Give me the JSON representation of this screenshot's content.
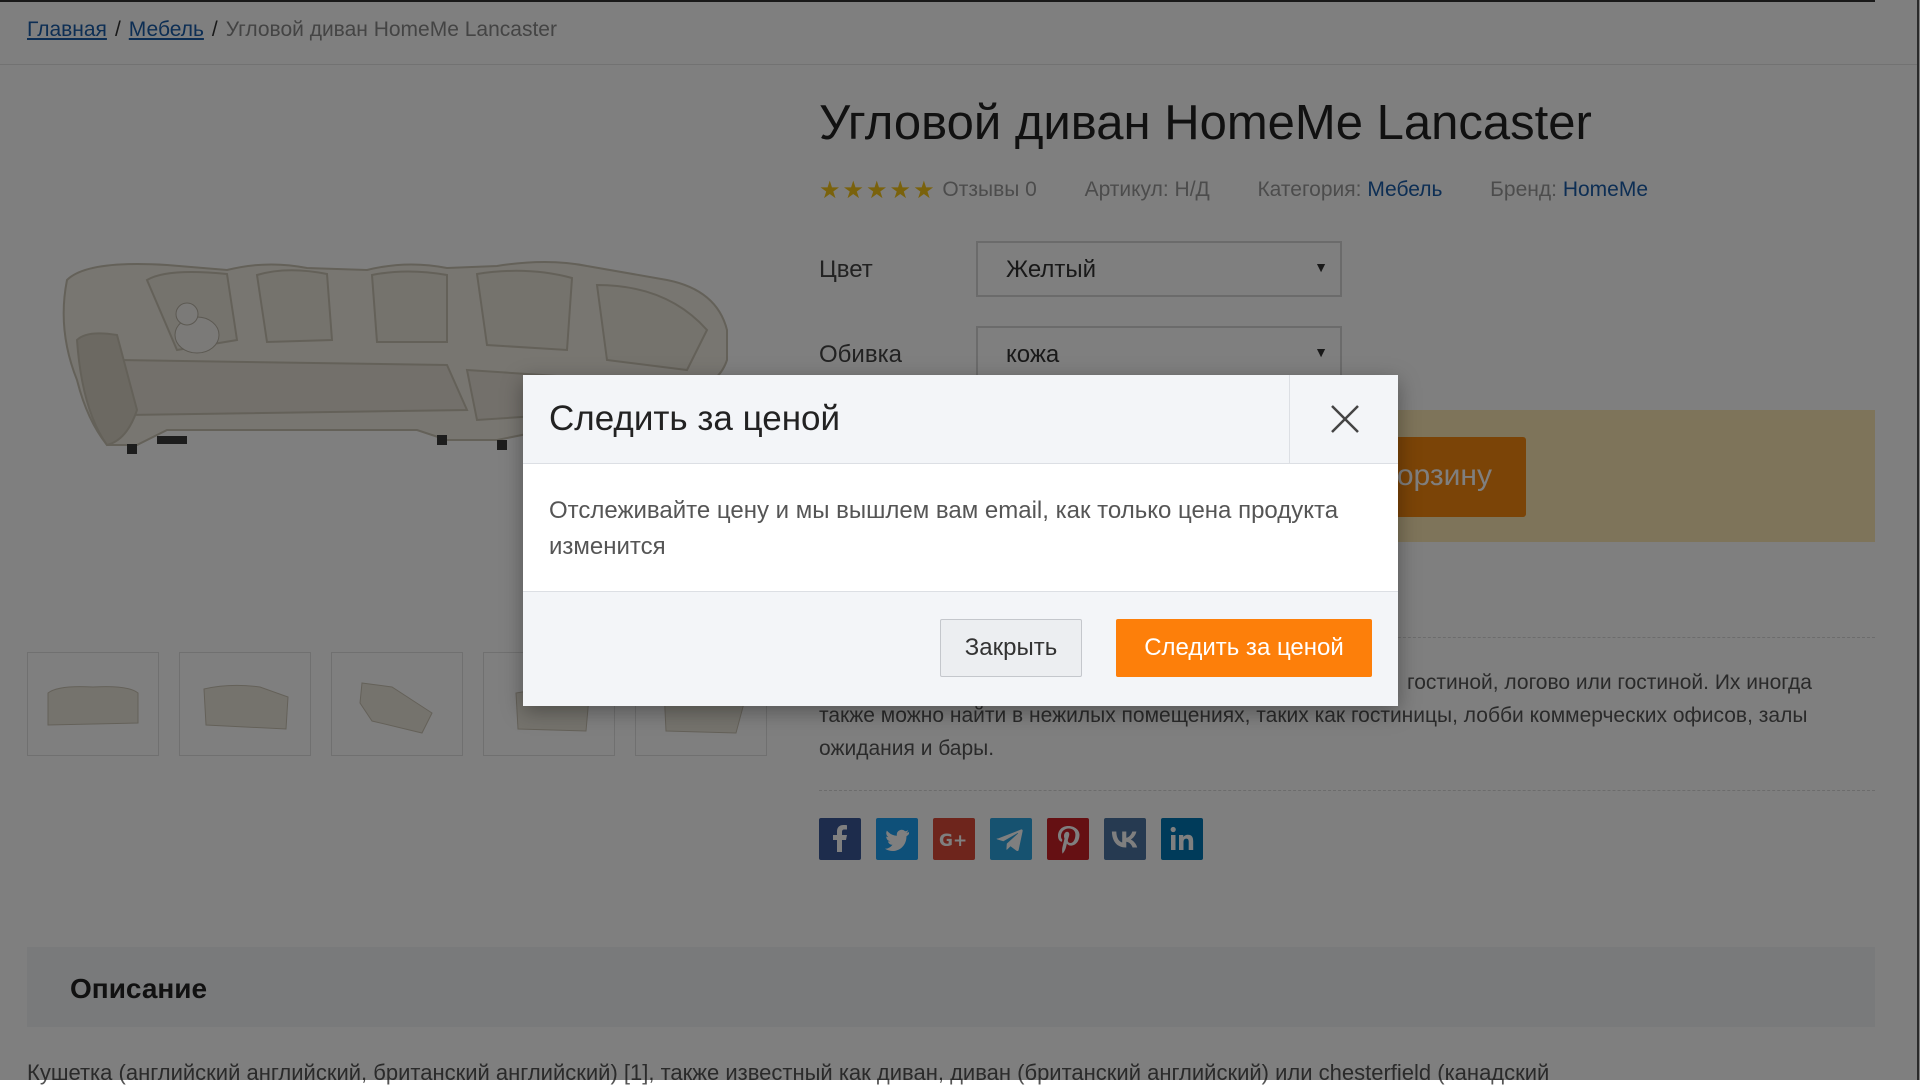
{
  "breadcrumb": {
    "home": "Главная",
    "category": "Мебель",
    "current": "Угловой диван HomeMe Lancaster",
    "separator": "/"
  },
  "product": {
    "title": "Угловой диван HomeMe Lancaster",
    "stars": "★★★★★",
    "reviews": "Отзывы 0",
    "sku_label": "Артикул:",
    "sku_value": "Н/Д",
    "category_label": "Категория:",
    "category_value": "Мебель",
    "brand_label": "Бренд:",
    "brand_value": "HomeMe"
  },
  "options": {
    "color_label": "Цвет",
    "color_value": "Желтый",
    "upholstery_label": "Обивка",
    "upholstery_value": "кожа",
    "select_arrow": "▼"
  },
  "cart": {
    "button_label_visible": "орзину"
  },
  "short_description": {
    "line1": "гостиной, логово или гостиной. Их иногда",
    "line2": "также можно найти в нежилых помещениях, таких как гостиницы, лобби коммерческих офисов, залы",
    "line3": "ожидания и бары."
  },
  "social": [
    {
      "name": "facebook",
      "color": "#3b5998"
    },
    {
      "name": "twitter",
      "color": "#1da1f2"
    },
    {
      "name": "google-plus",
      "color": "#dd4b39"
    },
    {
      "name": "telegram",
      "color": "#2ca5e0"
    },
    {
      "name": "pinterest",
      "color": "#cb2027"
    },
    {
      "name": "vk",
      "color": "#4c75a3"
    },
    {
      "name": "linkedin",
      "color": "#0077b5"
    }
  ],
  "tabs": {
    "description": "Описание"
  },
  "long_description": "Кушетка (английский английский, британский английский) [1], также известный как диван, диван (британский английский) или chesterfield (канадский",
  "modal": {
    "title": "Следить за ценой",
    "body": "Отслеживайте цену и мы вышлем вам email, как только цена продукта изменится",
    "close_button": "Закрыть",
    "track_button": "Следить за ценой"
  },
  "colors": {
    "accent": "#fd7f0a",
    "link": "#1a5da8"
  }
}
